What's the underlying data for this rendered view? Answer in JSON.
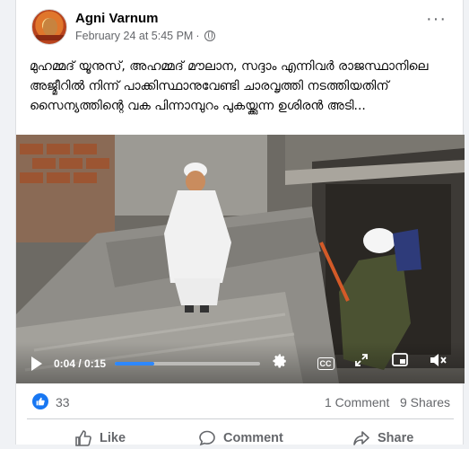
{
  "post": {
    "author": "Agni Varnum",
    "date": "February 24 at 5:45 PM",
    "separator": "·",
    "text": "മുഹമ്മദ് യൂനുസ്, അഹമ്മദ് മൗലാന, സദ്ദാം എന്നിവർ രാജസ്ഥാനിലെ അജ്മീറിൽ നിന്ന് പാക്കിസ്ഥാനുവേണ്ടി ചാരവൃത്തി നടത്തിയതിന് സൈന്യത്തിന്റെ വക പിന്നാമ്പുറം പുകയ്ക്കുന്ന ഉശിരൻ അടി..."
  },
  "video": {
    "time_current": "0:04",
    "time_separator": " / ",
    "time_total": "0:15",
    "progress": 0.27,
    "cc_label": "CC"
  },
  "engagement": {
    "reaction_count": "33",
    "comments": "1 Comment",
    "shares": "9 Shares"
  },
  "actions": {
    "like": "Like",
    "comment": "Comment",
    "share": "Share"
  },
  "colors": {
    "accent": "#1877f2",
    "progress": "#2d88ff",
    "secondary_text": "#65676b"
  },
  "icons": [
    "more-icon",
    "globe-icon",
    "play-icon",
    "settings-icon",
    "cc-icon",
    "fullscreen-icon",
    "pip-icon",
    "volume-icon",
    "like-icon",
    "comment-icon",
    "share-icon"
  ]
}
